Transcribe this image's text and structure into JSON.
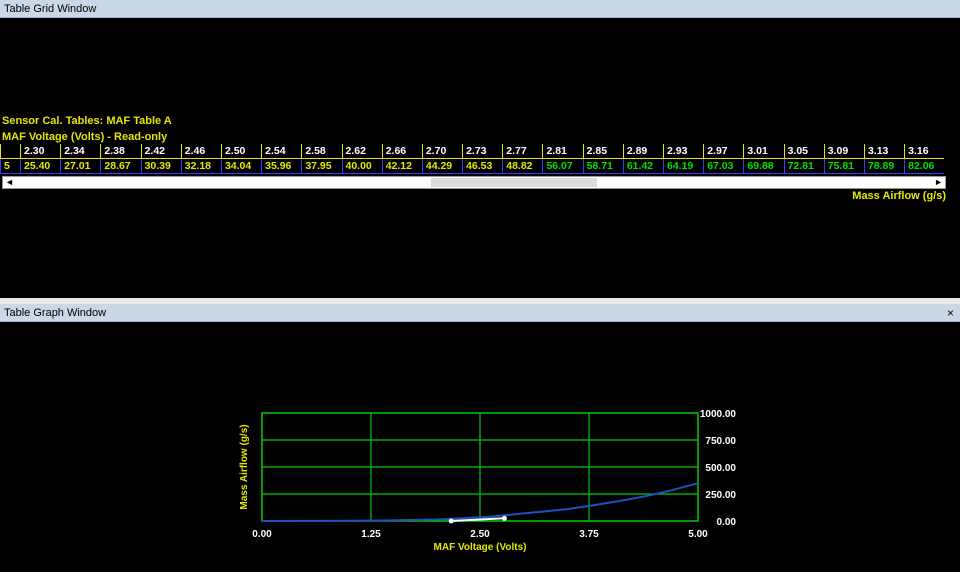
{
  "windows": {
    "grid_title": "Table Grid Window",
    "graph_title": "Table Graph Window",
    "close_glyph": "×"
  },
  "table": {
    "title": "Sensor Cal. Tables: MAF Table A",
    "axis_label": "MAF Voltage (Volts) - Read-only",
    "z_label": "Mass Airflow (g/s)",
    "row_label": "5",
    "row_header_top": "",
    "columns": [
      "2.30",
      "2.34",
      "2.38",
      "2.42",
      "2.46",
      "2.50",
      "2.54",
      "2.58",
      "2.62",
      "2.66",
      "2.70",
      "2.73",
      "2.77",
      "2.81",
      "2.85",
      "2.89",
      "2.93",
      "2.97",
      "3.01",
      "3.05",
      "3.09",
      "3.13",
      "3.16"
    ],
    "values": [
      "25.40",
      "27.01",
      "28.67",
      "30.39",
      "32.18",
      "34.04",
      "35.96",
      "37.95",
      "40.00",
      "42.12",
      "44.29",
      "46.53",
      "48.82",
      "56.07",
      "58.71",
      "61.42",
      "64.19",
      "67.03",
      "69.88",
      "72.81",
      "75.81",
      "78.89",
      "82.06"
    ],
    "highlight_from_index": 13,
    "colors": {
      "normal": "#e6e600",
      "modified": "#00e000"
    }
  },
  "chart_data": {
    "type": "line",
    "xlabel": "MAF Voltage (Volts)",
    "ylabel": "Mass Airflow (g/s)",
    "xlim": [
      0,
      5
    ],
    "ylim": [
      0,
      1000
    ],
    "x_ticks": [
      "0.00",
      "1.25",
      "2.50",
      "3.75",
      "5.00"
    ],
    "y_ticks": [
      "0.00",
      "250.00",
      "500.00",
      "750.00",
      "1000.00"
    ],
    "grid": true,
    "series": [
      {
        "color": "#2050c0",
        "x": [
          0.0,
          0.5,
          1.0,
          1.5,
          2.0,
          2.3,
          2.6,
          2.9,
          3.2,
          3.5,
          3.8,
          4.1,
          4.4,
          4.7,
          5.0
        ],
        "y": [
          0,
          1,
          3,
          6,
          14,
          25,
          38,
          62,
          85,
          110,
          145,
          185,
          230,
          285,
          350
        ]
      },
      {
        "color": "#ffffff",
        "x": [
          2.17,
          2.78
        ],
        "y": [
          0,
          25
        ]
      }
    ]
  }
}
